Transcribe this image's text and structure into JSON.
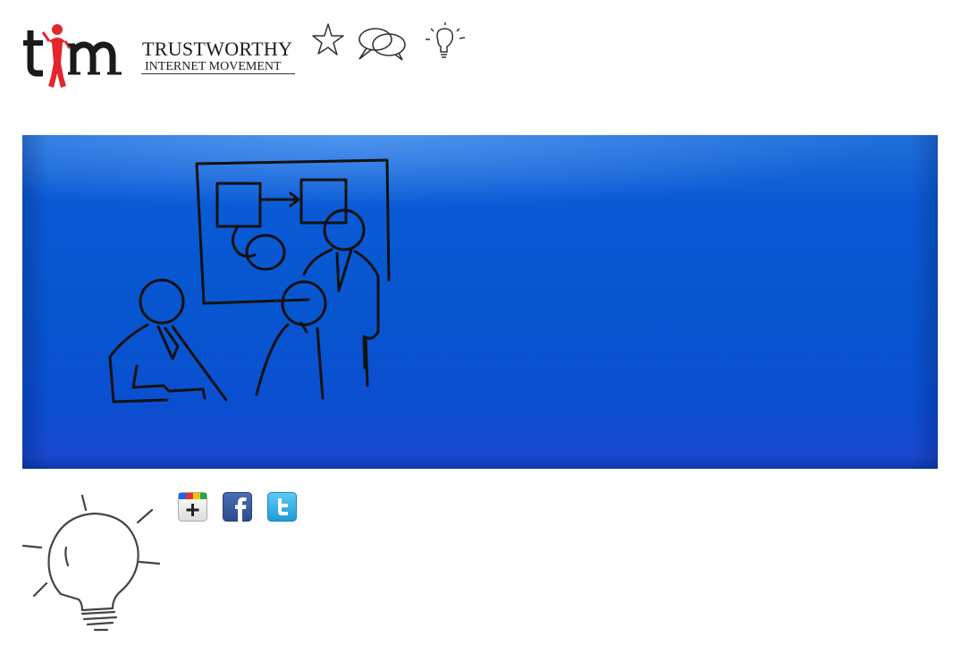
{
  "header": {
    "logo": {
      "wordmark": "tim",
      "title": "TRUSTWORTHY",
      "subtitle": "INTERNET MOVEMENT",
      "brand_color": "#e3262c"
    },
    "nav_icons": [
      {
        "icon": "star-icon"
      },
      {
        "icon": "chat-bubbles-icon"
      },
      {
        "icon": "lightbulb-icon"
      }
    ]
  },
  "hero": {
    "background_color": "#0756d0",
    "illustration": "whiteboard-meeting-sketch"
  },
  "share": {
    "buttons": [
      {
        "icon": "google-plus-icon",
        "color": "#ffffff"
      },
      {
        "icon": "facebook-icon",
        "color": "#3b5998"
      },
      {
        "icon": "twitter-icon",
        "color": "#33aee8"
      }
    ]
  },
  "footer_illustration": "lightbulb-sketch"
}
